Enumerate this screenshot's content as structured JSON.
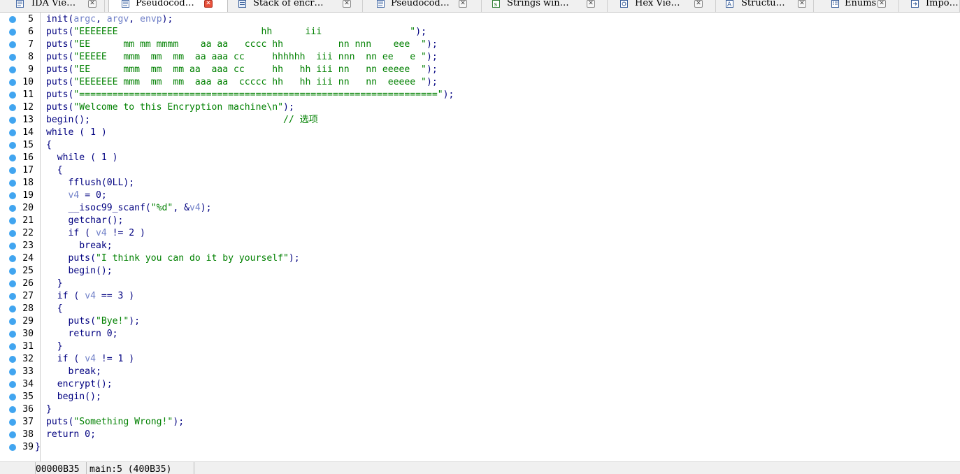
{
  "tabs": [
    {
      "label": "IDA Vie…",
      "icon": "ida-view-icon",
      "close": "normal"
    },
    {
      "label": "Pseudocod…",
      "icon": "pseudocode-icon",
      "close": "active",
      "active": true
    },
    {
      "label": "Stack of encr…",
      "icon": "stack-icon",
      "close": "normal"
    },
    {
      "label": "Pseudocod…",
      "icon": "pseudocode-icon",
      "close": "normal"
    },
    {
      "label": "Strings win…",
      "icon": "strings-icon",
      "close": "normal"
    },
    {
      "label": "Hex Vie…",
      "icon": "hex-view-icon",
      "close": "normal"
    },
    {
      "label": "Structu…",
      "icon": "structures-icon",
      "close": "normal"
    },
    {
      "label": "Enums",
      "icon": "enums-icon",
      "close": "normal"
    },
    {
      "label": "Impo…",
      "icon": "imports-icon",
      "close": "none"
    }
  ],
  "code_lines": [
    {
      "n": "5",
      "segs": [
        [
          "p",
          "init("
        ],
        [
          "v",
          "argc"
        ],
        [
          "p",
          ", "
        ],
        [
          "v",
          "argv"
        ],
        [
          "p",
          ", "
        ],
        [
          "v",
          "envp"
        ],
        [
          "p",
          ");"
        ]
      ]
    },
    {
      "n": "6",
      "segs": [
        [
          "p",
          "puts("
        ],
        [
          "s",
          "\"EEEEEEE                          hh      iii                \""
        ],
        [
          "p",
          ");"
        ]
      ]
    },
    {
      "n": "7",
      "segs": [
        [
          "p",
          "puts("
        ],
        [
          "s",
          "\"EE      mm mm mmmm    aa aa   cccc hh          nn nnn    eee  \""
        ],
        [
          "p",
          ");"
        ]
      ]
    },
    {
      "n": "8",
      "segs": [
        [
          "p",
          "puts("
        ],
        [
          "s",
          "\"EEEEE   mmm  mm  mm  aa aaa cc     hhhhhh  iii nnn  nn ee   e \""
        ],
        [
          "p",
          ");"
        ]
      ]
    },
    {
      "n": "9",
      "segs": [
        [
          "p",
          "puts("
        ],
        [
          "s",
          "\"EE      mmm  mm  mm aa  aaa cc     hh   hh iii nn   nn eeeee  \""
        ],
        [
          "p",
          ");"
        ]
      ]
    },
    {
      "n": "10",
      "segs": [
        [
          "p",
          "puts("
        ],
        [
          "s",
          "\"EEEEEEE mmm  mm  mm  aaa aa  ccccc hh   hh iii nn   nn  eeeee \""
        ],
        [
          "p",
          ");"
        ]
      ]
    },
    {
      "n": "11",
      "segs": [
        [
          "p",
          "puts("
        ],
        [
          "s",
          "\"=================================================================\""
        ],
        [
          "p",
          ");"
        ]
      ]
    },
    {
      "n": "12",
      "segs": [
        [
          "p",
          "puts("
        ],
        [
          "s",
          "\"Welcome to this Encryption machine\\n\""
        ],
        [
          "p",
          ");"
        ]
      ]
    },
    {
      "n": "13",
      "segs": [
        [
          "p",
          "begin();                                   "
        ],
        [
          "c",
          "// 选项"
        ]
      ]
    },
    {
      "n": "14",
      "segs": [
        [
          "p",
          "while ( 1 )"
        ]
      ]
    },
    {
      "n": "15",
      "segs": [
        [
          "p",
          "{"
        ]
      ]
    },
    {
      "n": "16",
      "segs": [
        [
          "p",
          "  while ( 1 )"
        ]
      ]
    },
    {
      "n": "17",
      "segs": [
        [
          "p",
          "  {"
        ]
      ]
    },
    {
      "n": "18",
      "segs": [
        [
          "p",
          "    fflush(0LL);"
        ]
      ]
    },
    {
      "n": "19",
      "segs": [
        [
          "p",
          "    "
        ],
        [
          "v",
          "v4"
        ],
        [
          "p",
          " = 0;"
        ]
      ]
    },
    {
      "n": "20",
      "segs": [
        [
          "p",
          "    __isoc99_scanf("
        ],
        [
          "s",
          "\"%d\""
        ],
        [
          "p",
          ", &"
        ],
        [
          "v",
          "v4"
        ],
        [
          "p",
          ");"
        ]
      ]
    },
    {
      "n": "21",
      "segs": [
        [
          "p",
          "    getchar();"
        ]
      ]
    },
    {
      "n": "22",
      "segs": [
        [
          "p",
          "    if ( "
        ],
        [
          "v",
          "v4"
        ],
        [
          "p",
          " != 2 )"
        ]
      ]
    },
    {
      "n": "23",
      "segs": [
        [
          "p",
          "      break;"
        ]
      ]
    },
    {
      "n": "24",
      "segs": [
        [
          "p",
          "    puts("
        ],
        [
          "s",
          "\"I think you can do it by yourself\""
        ],
        [
          "p",
          ");"
        ]
      ]
    },
    {
      "n": "25",
      "segs": [
        [
          "p",
          "    begin();"
        ]
      ]
    },
    {
      "n": "26",
      "segs": [
        [
          "p",
          "  }"
        ]
      ]
    },
    {
      "n": "27",
      "segs": [
        [
          "p",
          "  if ( "
        ],
        [
          "v",
          "v4"
        ],
        [
          "p",
          " == 3 )"
        ]
      ]
    },
    {
      "n": "28",
      "segs": [
        [
          "p",
          "  {"
        ]
      ]
    },
    {
      "n": "29",
      "segs": [
        [
          "p",
          "    puts("
        ],
        [
          "s",
          "\"Bye!\""
        ],
        [
          "p",
          ");"
        ]
      ]
    },
    {
      "n": "30",
      "segs": [
        [
          "p",
          "    return 0;"
        ]
      ]
    },
    {
      "n": "31",
      "segs": [
        [
          "p",
          "  }"
        ]
      ]
    },
    {
      "n": "32",
      "segs": [
        [
          "p",
          "  if ( "
        ],
        [
          "v",
          "v4"
        ],
        [
          "p",
          " != 1 )"
        ]
      ]
    },
    {
      "n": "33",
      "segs": [
        [
          "p",
          "    break;"
        ]
      ]
    },
    {
      "n": "34",
      "segs": [
        [
          "p",
          "  encrypt();"
        ]
      ]
    },
    {
      "n": "35",
      "segs": [
        [
          "p",
          "  begin();"
        ]
      ]
    },
    {
      "n": "36",
      "segs": [
        [
          "p",
          "}"
        ]
      ]
    },
    {
      "n": "37",
      "segs": [
        [
          "p",
          "puts("
        ],
        [
          "s",
          "\"Something Wrong!\""
        ],
        [
          "p",
          ");"
        ]
      ]
    },
    {
      "n": "38",
      "segs": [
        [
          "p",
          "return 0;"
        ]
      ]
    },
    {
      "n": "39",
      "segs": [
        [
          "p",
          "}"
        ]
      ]
    }
  ],
  "status": {
    "address": "00000B35",
    "location": "main:5 (400B35)"
  },
  "colors": {
    "keyword": "#000080",
    "string": "#008000",
    "variable": "#7080c8",
    "breakpoint_dot": "#41a5f0",
    "close_active": "#e8503a"
  }
}
